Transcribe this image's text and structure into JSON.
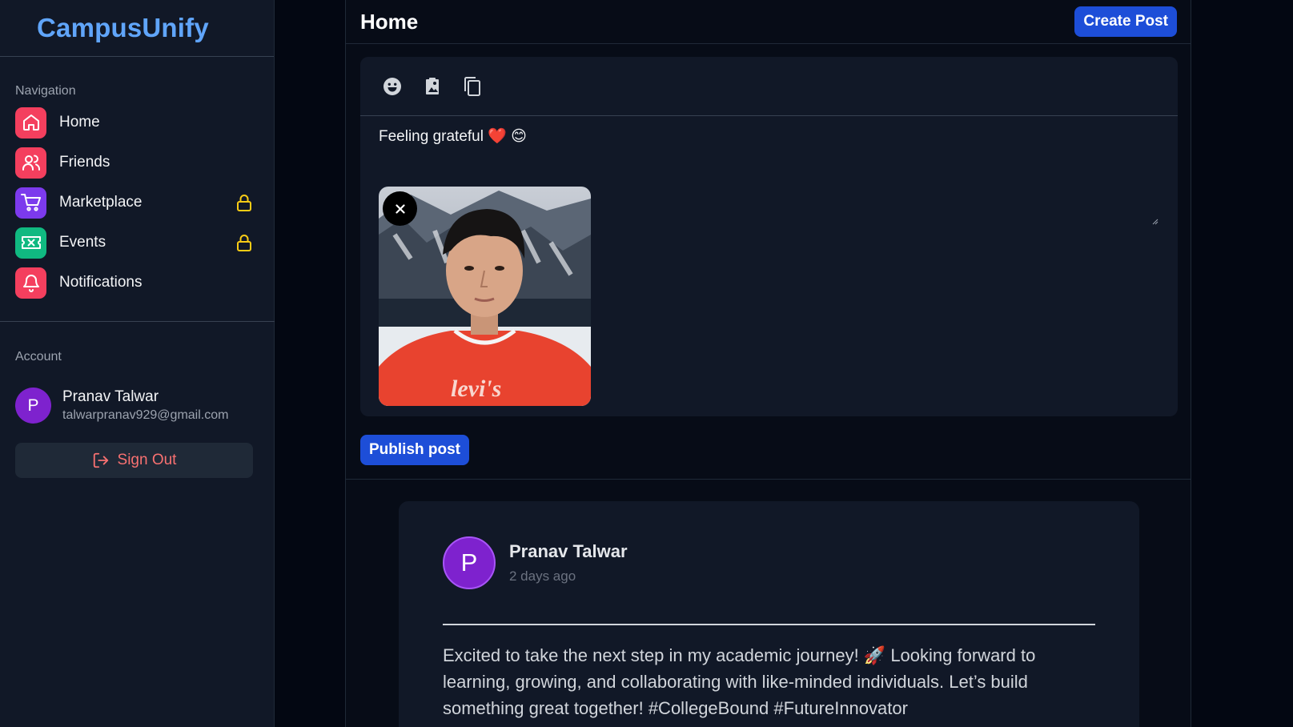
{
  "brand": {
    "name": "CampusUnify"
  },
  "nav": {
    "title": "Navigation",
    "items": [
      {
        "label": "Home",
        "icon": "home-icon",
        "color": "#f43f5e",
        "locked": false
      },
      {
        "label": "Friends",
        "icon": "users-icon",
        "color": "#f43f5e",
        "locked": false
      },
      {
        "label": "Marketplace",
        "icon": "cart-icon",
        "color": "#7c3aed",
        "locked": true
      },
      {
        "label": "Events",
        "icon": "ticket-icon",
        "color": "#10b981",
        "locked": true
      },
      {
        "label": "Notifications",
        "icon": "bell-icon",
        "color": "#f43f5e",
        "locked": false
      }
    ]
  },
  "account": {
    "title": "Account",
    "initial": "P",
    "name": "Pranav Talwar",
    "email": "talwarpranav929@gmail.com",
    "signout_label": "Sign Out"
  },
  "header": {
    "title": "Home",
    "create_label": "Create Post"
  },
  "composer": {
    "text": "Feeling grateful ❤️ 😊",
    "tools": [
      "emoji-icon",
      "image-icon",
      "copy-icon"
    ],
    "publish_label": "Publish post"
  },
  "post": {
    "initial": "P",
    "author": "Pranav Talwar",
    "time": "2 days ago",
    "body": "Excited to take the next step in my academic journey! 🚀 Looking forward to learning, growing, and collaborating with like-minded individuals. Let’s build something great together! #CollegeBound #FutureInnovator"
  },
  "colors": {
    "accent": "#1d4ed8",
    "brand": "#60a5fa",
    "avatar": "#7e22ce",
    "lock": "#facc15",
    "signout": "#f87171"
  }
}
